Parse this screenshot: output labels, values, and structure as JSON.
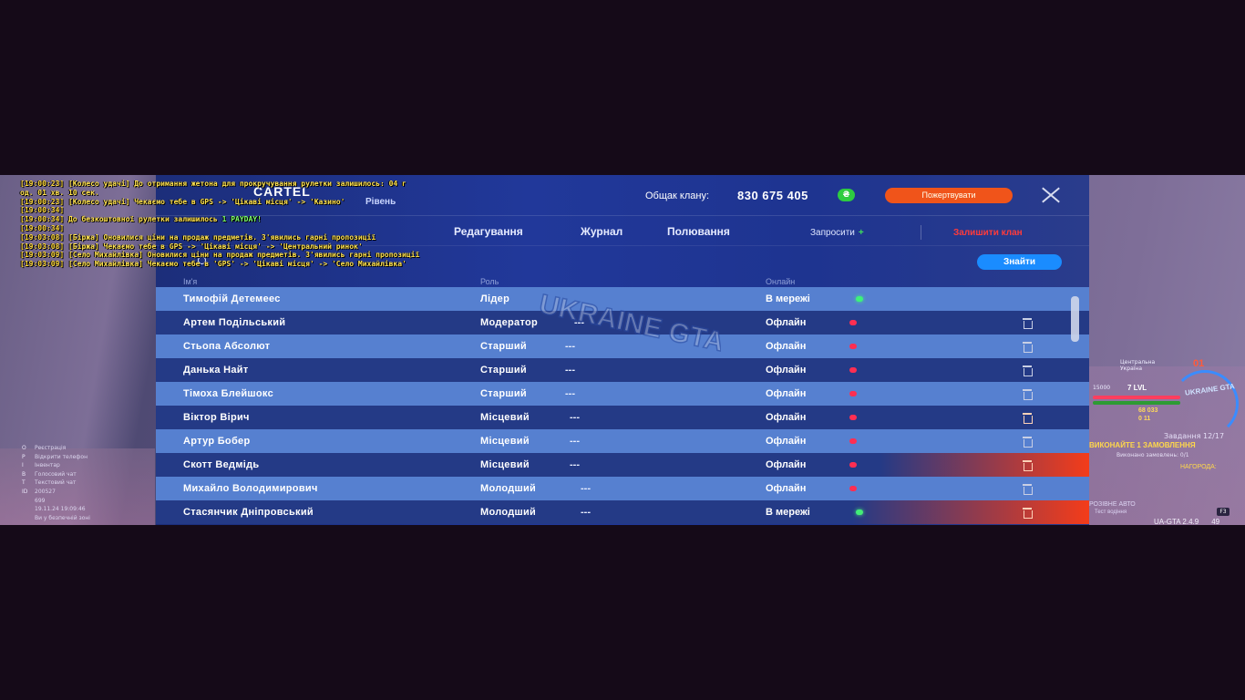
{
  "chat": [
    {
      "time": "[19:00:23]",
      "text": " [Колесо удачі] До отримання жетона для прокручування рулетки залишилось: 04 г"
    },
    {
      "time": "",
      "text": "од. 01 хв. 10 сек."
    },
    {
      "time": "[19:00:23]",
      "text": " [Колесо удачі] Чекаємо тебе в GPS -> 'Цікаві місця' -> 'Казино'"
    },
    {
      "time": "[19:00:34]",
      "text": ""
    },
    {
      "time": "[19:00:34]",
      "text": " До безкоштовної рулетки залишилось ",
      "highlight": "1 PAYDAY!"
    },
    {
      "time": "[19:00:34]",
      "text": ""
    },
    {
      "time": "[19:03:08]",
      "text": " [Біржа] Оновилися ціни на продаж предметів. З'явились гарні пропозиції"
    },
    {
      "time": "[19:03:08]",
      "text": " [Біржа] Чекаємо тебе в GPS -> 'Цікаві місця' -> 'Центральний ринок'"
    },
    {
      "time": "[19:03:09]",
      "text": " [Село Михайлівка] Оновилися ціни на продаж предметів. З'явились гарні пропозиції"
    },
    {
      "time": "[19:03:09]",
      "text": " [Село Михайлівка] Чекаємо тебе в 'GPS' -> 'Цікаві місця' -> 'Село Михайлівка'"
    }
  ],
  "panel": {
    "clan_name": "CARTEL",
    "clan_sub": "Рівень",
    "bank_label": "Общак клану:",
    "bank_value": "830 675 405",
    "bank_icon": "₴",
    "donate_label": "Пожертвувати",
    "tabs": {
      "edit": "Редагування",
      "journal": "Журнал",
      "hunt": "Полювання"
    },
    "invite_label": "Запросити",
    "invite_plus": "+",
    "leave_label": "Залишити клан",
    "search_placeholder": "",
    "find_label": "Знайти",
    "columns": {
      "name": "Ім'я",
      "role": "Роль",
      "online": "Онлайн"
    },
    "members": [
      {
        "name": "Тимофій Детемеес",
        "role": "Лідер",
        "extra": "",
        "status": "В мережі",
        "online": true,
        "deletable": false
      },
      {
        "name": "Артем Подільський",
        "role": "Модератор",
        "extra": "---",
        "status": "Офлайн",
        "online": false,
        "deletable": true
      },
      {
        "name": "Стьопа Абсолют",
        "role": "Старший",
        "extra": "---",
        "status": "Офлайн",
        "online": false,
        "deletable": true
      },
      {
        "name": "Данька Найт",
        "role": "Старший",
        "extra": "---",
        "status": "Офлайн",
        "online": false,
        "deletable": true
      },
      {
        "name": "Тімоха Блейшокс",
        "role": "Старший",
        "extra": "---",
        "status": "Офлайн",
        "online": false,
        "deletable": true
      },
      {
        "name": "Віктор Вірич",
        "role": "Місцевий",
        "extra": "---",
        "status": "Офлайн",
        "online": false,
        "deletable": true
      },
      {
        "name": "Артур Бобер",
        "role": "Місцевий",
        "extra": "---",
        "status": "Офлайн",
        "online": false,
        "deletable": true
      },
      {
        "name": "Скотт Ведмідь",
        "role": "Місцевий",
        "extra": "---",
        "status": "Офлайн",
        "online": false,
        "deletable": true
      },
      {
        "name": "Михайло Володимирович",
        "role": "Молодший",
        "extra": "---",
        "status": "Офлайн",
        "online": false,
        "deletable": true
      },
      {
        "name": "Стасянчик Дніпровський",
        "role": "Молодший",
        "extra": "---",
        "status": "В мережі",
        "online": true,
        "deletable": true
      }
    ],
    "watermark": "UKRAINE GTA"
  },
  "left_hud": [
    {
      "key": "O",
      "label": "Реєстрація"
    },
    {
      "key": "P",
      "label": "Відкрити телефон"
    },
    {
      "key": "I",
      "label": "Інвентар"
    },
    {
      "key": "B",
      "label": "Голосовий чат"
    },
    {
      "key": "T",
      "label": "Текстовий чат"
    },
    {
      "key": "ID",
      "label": "200527"
    },
    {
      "key": "",
      "label": "699"
    },
    {
      "key": "",
      "label": "19.11.24 19:09:46"
    },
    {
      "key": "",
      "label": "Ви у безпечній зоні"
    }
  ],
  "right_hud": {
    "region": "Центральна Україна",
    "region_num": "01",
    "level": "7 LVL",
    "xp": "15000",
    "money": "68 033",
    "money2": "0 11",
    "task": "Завдання 12/17",
    "order": "ВИКОНАЙТЕ 1 ЗАМОВЛЕННЯ",
    "done": "Виконано замовлень: 0/1",
    "reward": "НАГОРОДА:",
    "auto": "РОЗІВНЕ АВТО",
    "auto_sub": "Тест водіння",
    "key": "F3",
    "badge": "UKRAINE GTA",
    "version": "UA-GTA 2.4.9",
    "fps": "49"
  },
  "colors": {
    "online": "#3df27a",
    "offline": "#ff2e52",
    "donate": "#f0541a",
    "find": "#1a8cff",
    "leave": "#ff3b3b"
  }
}
